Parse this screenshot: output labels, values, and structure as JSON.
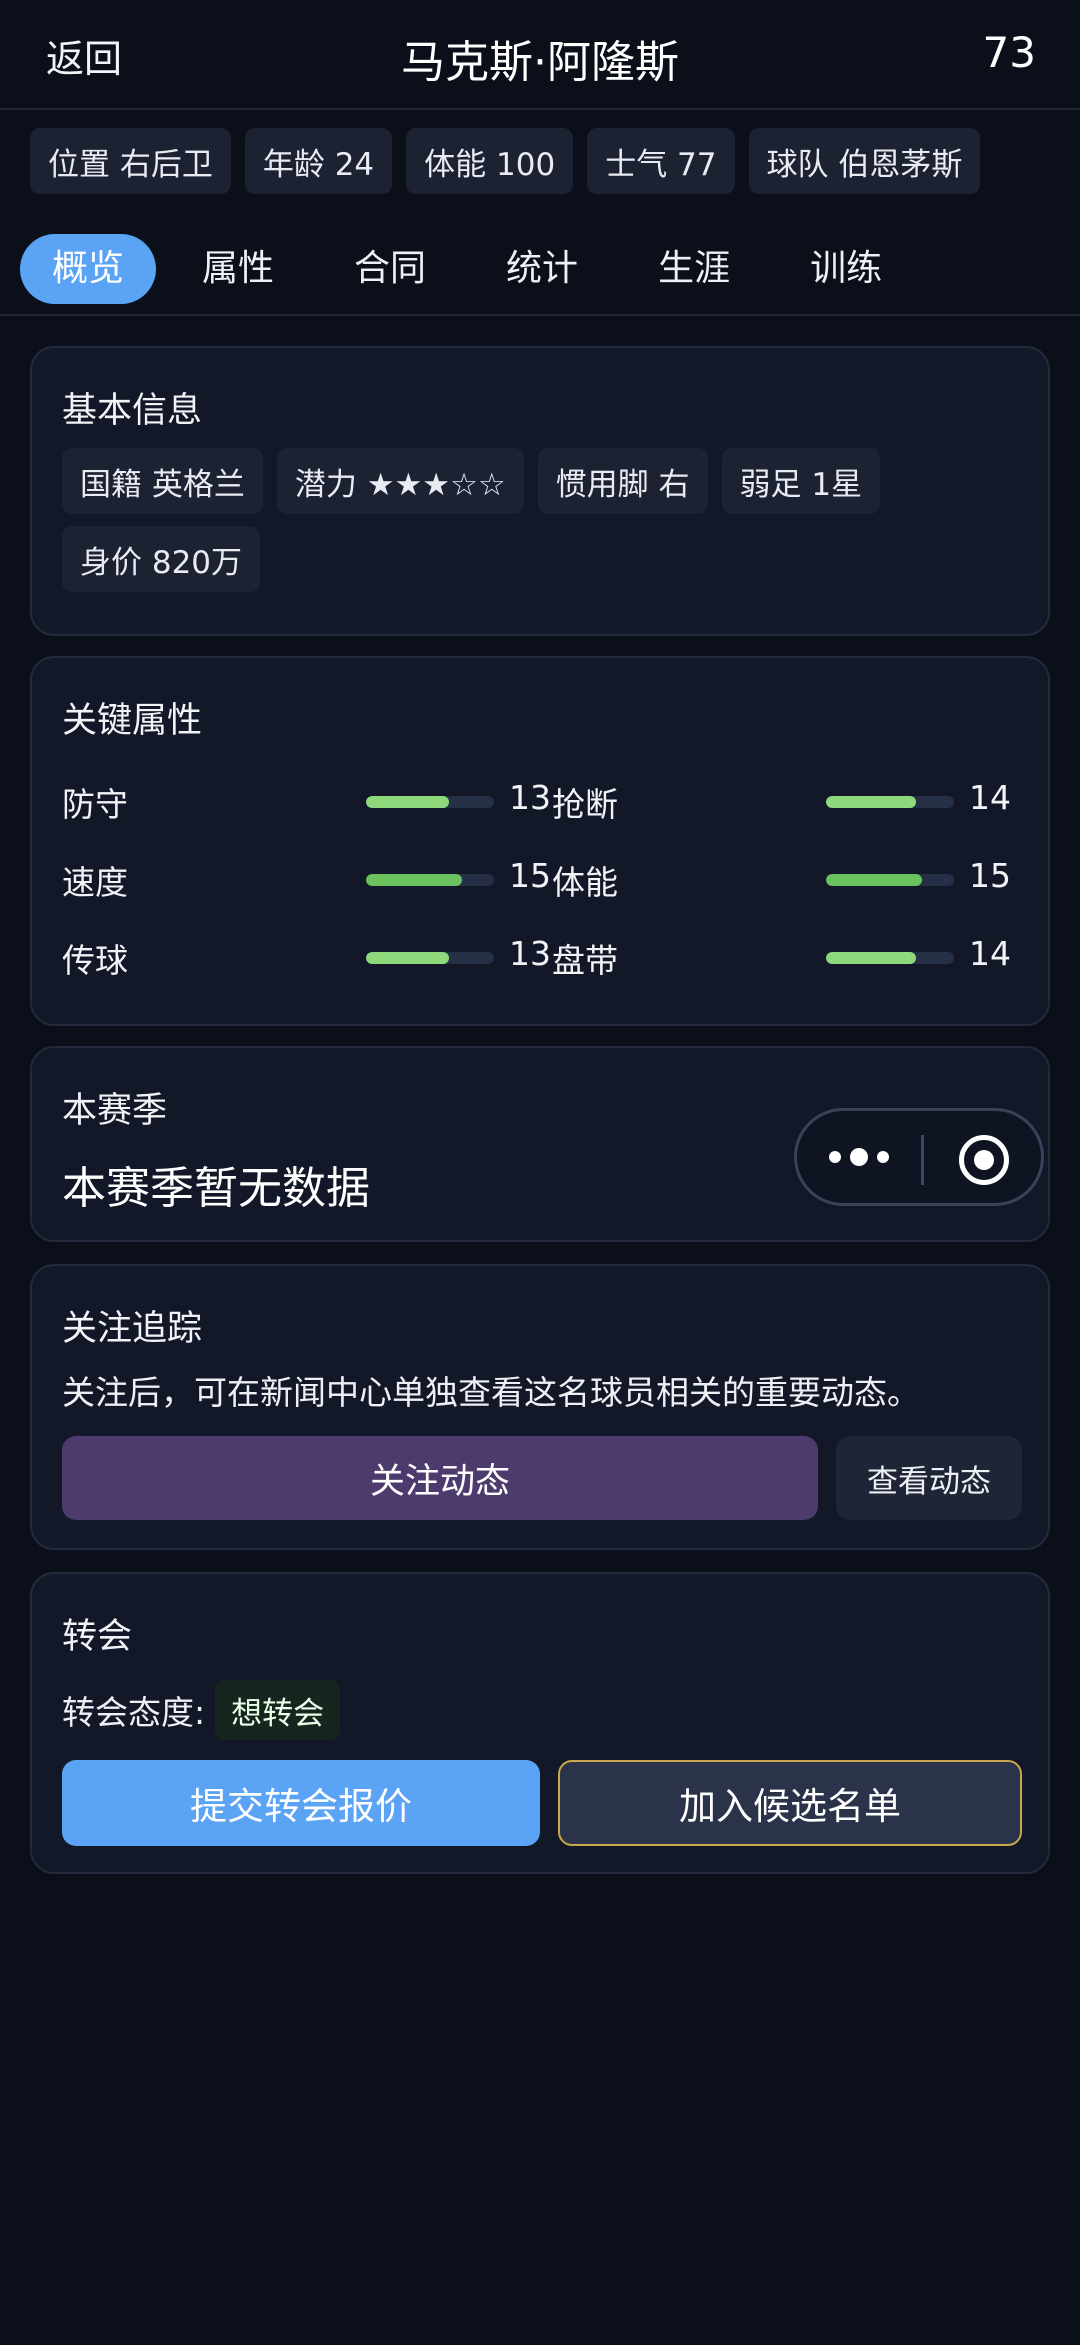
{
  "header": {
    "back_label": "返回",
    "title": "马克斯·阿隆斯",
    "rating": "73"
  },
  "summary_chips": [
    "位置 右后卫",
    "年龄 24",
    "体能 100",
    "士气 77",
    "球队 伯恩茅斯"
  ],
  "tabs": [
    {
      "label": "概览",
      "active": true
    },
    {
      "label": "属性",
      "active": false
    },
    {
      "label": "合同",
      "active": false
    },
    {
      "label": "统计",
      "active": false
    },
    {
      "label": "生涯",
      "active": false
    },
    {
      "label": "训练",
      "active": false
    }
  ],
  "basic_info": {
    "title": "基本信息",
    "chips": [
      "国籍 英格兰",
      "潜力 ★★★☆☆",
      "惯用脚 右",
      "弱足 1星",
      "身价 820万"
    ]
  },
  "key_attributes": {
    "title": "关键属性",
    "max": 20,
    "rows": [
      {
        "left": {
          "name": "防守",
          "value": "13"
        },
        "right": {
          "name": "抢断",
          "value": "14"
        }
      },
      {
        "left": {
          "name": "速度",
          "value": "15"
        },
        "right": {
          "name": "体能",
          "value": "15"
        }
      },
      {
        "left": {
          "name": "传球",
          "value": "13"
        },
        "right": {
          "name": "盘带",
          "value": "14"
        }
      }
    ],
    "bar_color_light": "#8fd97d",
    "bar_color_dark": "#6ac25e"
  },
  "season": {
    "title": "本赛季",
    "empty_text": "本赛季暂无数据"
  },
  "follow": {
    "title": "关注追踪",
    "description": "关注后，可在新闻中心单独查看这名球员相关的重要动态。",
    "follow_button": "关注动态",
    "view_button": "查看动态"
  },
  "transfer": {
    "title": "转会",
    "attitude_label": "转会态度:",
    "attitude_value": "想转会",
    "offer_button": "提交转会报价",
    "shortlist_button": "加入候选名单"
  },
  "colors": {
    "accent": "#5aa3f5",
    "follow_button": "#4e3b6e",
    "shortlist_border": "#c8a84a"
  }
}
